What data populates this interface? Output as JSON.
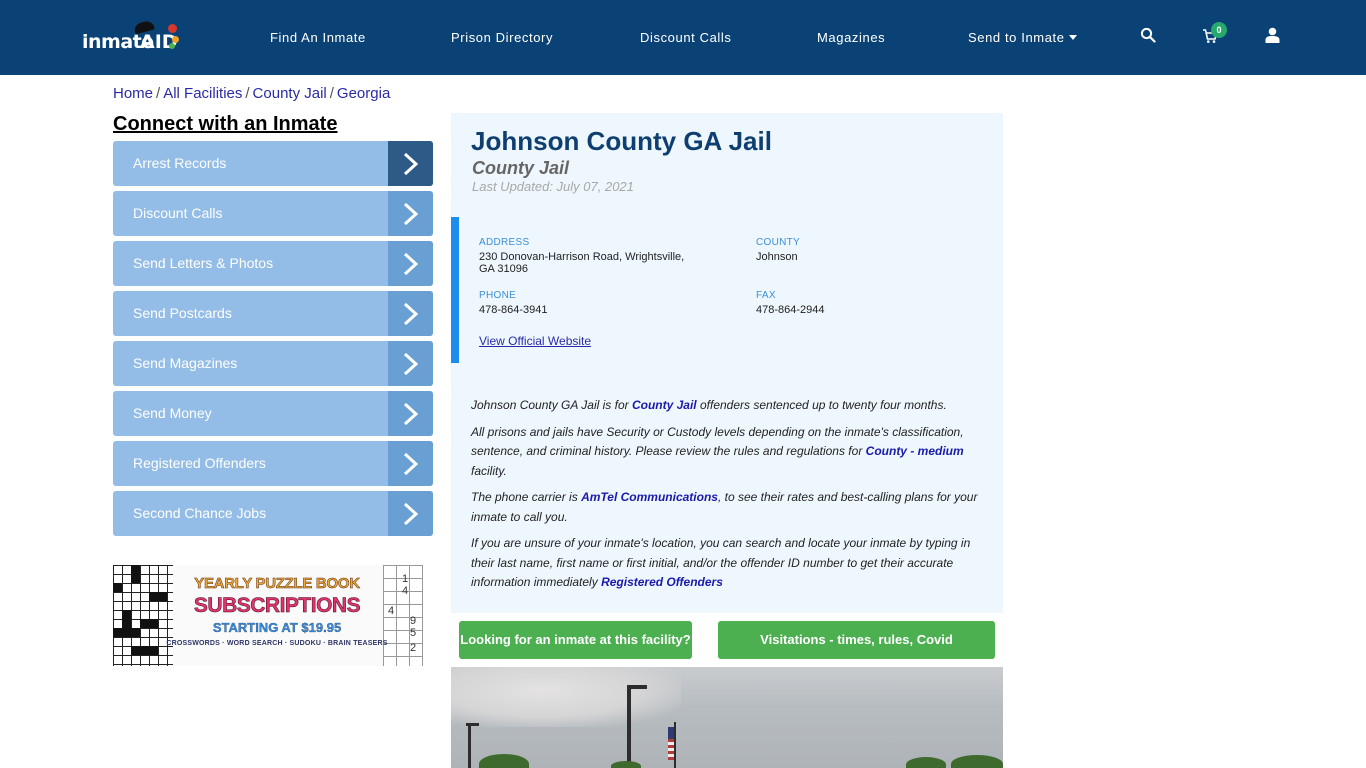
{
  "header": {
    "logo": {
      "text_left": "inmate",
      "text_right": "AID"
    },
    "nav": [
      {
        "label": "Find An Inmate"
      },
      {
        "label": "Prison Directory"
      },
      {
        "label": "Discount Calls"
      },
      {
        "label": "Magazines"
      },
      {
        "label": "Send to Inmate",
        "has_dropdown": true
      }
    ],
    "icons": {
      "search": "search-icon",
      "cart": "cart-icon",
      "user": "user-icon"
    },
    "cart_count": "0",
    "colors": {
      "navbar": "#0b4275",
      "badge": "#26a96c"
    }
  },
  "breadcrumb": [
    {
      "label": "Home"
    },
    {
      "label": "All Facilities"
    },
    {
      "label": "County Jail"
    },
    {
      "label": "Georgia"
    }
  ],
  "sidebar": {
    "title": "Connect with an Inmate",
    "items": [
      {
        "label": "Arrest Records",
        "active": true
      },
      {
        "label": "Discount Calls"
      },
      {
        "label": "Send Letters & Photos"
      },
      {
        "label": "Send Postcards"
      },
      {
        "label": "Send Magazines"
      },
      {
        "label": "Send Money"
      },
      {
        "label": "Registered Offenders"
      },
      {
        "label": "Second Chance Jobs"
      }
    ],
    "ad": {
      "line1": "YEARLY PUZZLE BOOK",
      "line2": "SUBSCRIPTIONS",
      "line3": "STARTING AT $19.95",
      "line4": "CROSSWORDS · WORD SEARCH · SUDOKU · BRAIN TEASERS",
      "sudoku_digits": [
        "1",
        "4",
        "4",
        "9",
        "5",
        "2"
      ]
    }
  },
  "facility": {
    "name": "Johnson County GA Jail",
    "type": "County Jail",
    "last_updated": "Last Updated: July 07, 2021",
    "address_label": "ADDRESS",
    "address_line1": "230 Donovan-Harrison Road, Wrightsville,",
    "address_line2": "GA 31096",
    "county_label": "COUNTY",
    "county": "Johnson",
    "phone_label": "PHONE",
    "phone": "478-864-3941",
    "fax_label": "FAX",
    "fax": "478-864-2944",
    "website_link": "View Official Website"
  },
  "description": {
    "p1_a": "Johnson County GA Jail is for ",
    "p1_link": "County Jail",
    "p1_b": " offenders sentenced up to twenty four months.",
    "p2_a": "All prisons and jails have Security or Custody levels depending on the inmate's classification, sentence, and criminal history. Please review the rules and regulations for ",
    "p2_link": "County - medium",
    "p2_b": " facility.",
    "p3_a": "The phone carrier is ",
    "p3_link": "AmTel Communications",
    "p3_b": ", to see their rates and best-calling plans for your inmate to call you.",
    "p4_a": "If you are unsure of your inmate's location, you can search and locate your inmate by typing in their last name, first name or first initial, and/or the offender ID number to get their accurate information immediately ",
    "p4_link": "Registered Offenders"
  },
  "actions": {
    "find_inmate": "Looking for an inmate at this facility?",
    "visitations": "Visitations - times, rules, Covid cancellations"
  }
}
